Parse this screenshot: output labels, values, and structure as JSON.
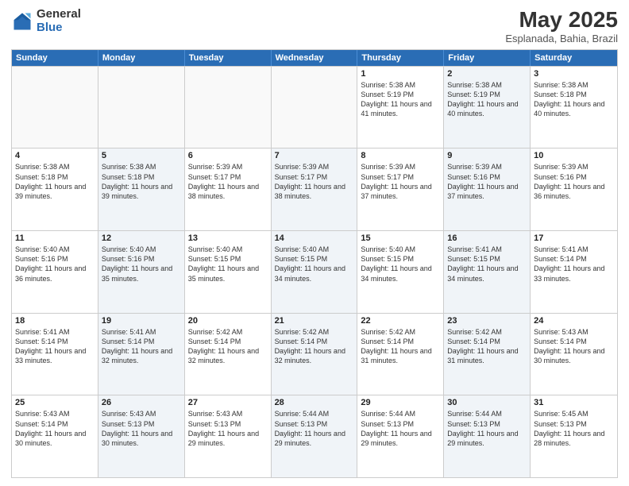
{
  "header": {
    "logo_general": "General",
    "logo_blue": "Blue",
    "title": "May 2025",
    "subtitle": "Esplanada, Bahia, Brazil"
  },
  "weekdays": [
    "Sunday",
    "Monday",
    "Tuesday",
    "Wednesday",
    "Thursday",
    "Friday",
    "Saturday"
  ],
  "rows": [
    [
      {
        "day": "",
        "text": "",
        "empty": true
      },
      {
        "day": "",
        "text": "",
        "empty": true
      },
      {
        "day": "",
        "text": "",
        "empty": true
      },
      {
        "day": "",
        "text": "",
        "empty": true
      },
      {
        "day": "1",
        "text": "Sunrise: 5:38 AM\nSunset: 5:19 PM\nDaylight: 11 hours and 41 minutes."
      },
      {
        "day": "2",
        "text": "Sunrise: 5:38 AM\nSunset: 5:19 PM\nDaylight: 11 hours and 40 minutes.",
        "shaded": true
      },
      {
        "day": "3",
        "text": "Sunrise: 5:38 AM\nSunset: 5:18 PM\nDaylight: 11 hours and 40 minutes."
      }
    ],
    [
      {
        "day": "4",
        "text": "Sunrise: 5:38 AM\nSunset: 5:18 PM\nDaylight: 11 hours and 39 minutes."
      },
      {
        "day": "5",
        "text": "Sunrise: 5:38 AM\nSunset: 5:18 PM\nDaylight: 11 hours and 39 minutes.",
        "shaded": true
      },
      {
        "day": "6",
        "text": "Sunrise: 5:39 AM\nSunset: 5:17 PM\nDaylight: 11 hours and 38 minutes."
      },
      {
        "day": "7",
        "text": "Sunrise: 5:39 AM\nSunset: 5:17 PM\nDaylight: 11 hours and 38 minutes.",
        "shaded": true
      },
      {
        "day": "8",
        "text": "Sunrise: 5:39 AM\nSunset: 5:17 PM\nDaylight: 11 hours and 37 minutes."
      },
      {
        "day": "9",
        "text": "Sunrise: 5:39 AM\nSunset: 5:16 PM\nDaylight: 11 hours and 37 minutes.",
        "shaded": true
      },
      {
        "day": "10",
        "text": "Sunrise: 5:39 AM\nSunset: 5:16 PM\nDaylight: 11 hours and 36 minutes."
      }
    ],
    [
      {
        "day": "11",
        "text": "Sunrise: 5:40 AM\nSunset: 5:16 PM\nDaylight: 11 hours and 36 minutes."
      },
      {
        "day": "12",
        "text": "Sunrise: 5:40 AM\nSunset: 5:16 PM\nDaylight: 11 hours and 35 minutes.",
        "shaded": true
      },
      {
        "day": "13",
        "text": "Sunrise: 5:40 AM\nSunset: 5:15 PM\nDaylight: 11 hours and 35 minutes."
      },
      {
        "day": "14",
        "text": "Sunrise: 5:40 AM\nSunset: 5:15 PM\nDaylight: 11 hours and 34 minutes.",
        "shaded": true
      },
      {
        "day": "15",
        "text": "Sunrise: 5:40 AM\nSunset: 5:15 PM\nDaylight: 11 hours and 34 minutes."
      },
      {
        "day": "16",
        "text": "Sunrise: 5:41 AM\nSunset: 5:15 PM\nDaylight: 11 hours and 34 minutes.",
        "shaded": true
      },
      {
        "day": "17",
        "text": "Sunrise: 5:41 AM\nSunset: 5:14 PM\nDaylight: 11 hours and 33 minutes."
      }
    ],
    [
      {
        "day": "18",
        "text": "Sunrise: 5:41 AM\nSunset: 5:14 PM\nDaylight: 11 hours and 33 minutes."
      },
      {
        "day": "19",
        "text": "Sunrise: 5:41 AM\nSunset: 5:14 PM\nDaylight: 11 hours and 32 minutes.",
        "shaded": true
      },
      {
        "day": "20",
        "text": "Sunrise: 5:42 AM\nSunset: 5:14 PM\nDaylight: 11 hours and 32 minutes."
      },
      {
        "day": "21",
        "text": "Sunrise: 5:42 AM\nSunset: 5:14 PM\nDaylight: 11 hours and 32 minutes.",
        "shaded": true
      },
      {
        "day": "22",
        "text": "Sunrise: 5:42 AM\nSunset: 5:14 PM\nDaylight: 11 hours and 31 minutes."
      },
      {
        "day": "23",
        "text": "Sunrise: 5:42 AM\nSunset: 5:14 PM\nDaylight: 11 hours and 31 minutes.",
        "shaded": true
      },
      {
        "day": "24",
        "text": "Sunrise: 5:43 AM\nSunset: 5:14 PM\nDaylight: 11 hours and 30 minutes."
      }
    ],
    [
      {
        "day": "25",
        "text": "Sunrise: 5:43 AM\nSunset: 5:14 PM\nDaylight: 11 hours and 30 minutes."
      },
      {
        "day": "26",
        "text": "Sunrise: 5:43 AM\nSunset: 5:13 PM\nDaylight: 11 hours and 30 minutes.",
        "shaded": true
      },
      {
        "day": "27",
        "text": "Sunrise: 5:43 AM\nSunset: 5:13 PM\nDaylight: 11 hours and 29 minutes."
      },
      {
        "day": "28",
        "text": "Sunrise: 5:44 AM\nSunset: 5:13 PM\nDaylight: 11 hours and 29 minutes.",
        "shaded": true
      },
      {
        "day": "29",
        "text": "Sunrise: 5:44 AM\nSunset: 5:13 PM\nDaylight: 11 hours and 29 minutes."
      },
      {
        "day": "30",
        "text": "Sunrise: 5:44 AM\nSunset: 5:13 PM\nDaylight: 11 hours and 29 minutes.",
        "shaded": true
      },
      {
        "day": "31",
        "text": "Sunrise: 5:45 AM\nSunset: 5:13 PM\nDaylight: 11 hours and 28 minutes."
      }
    ]
  ]
}
